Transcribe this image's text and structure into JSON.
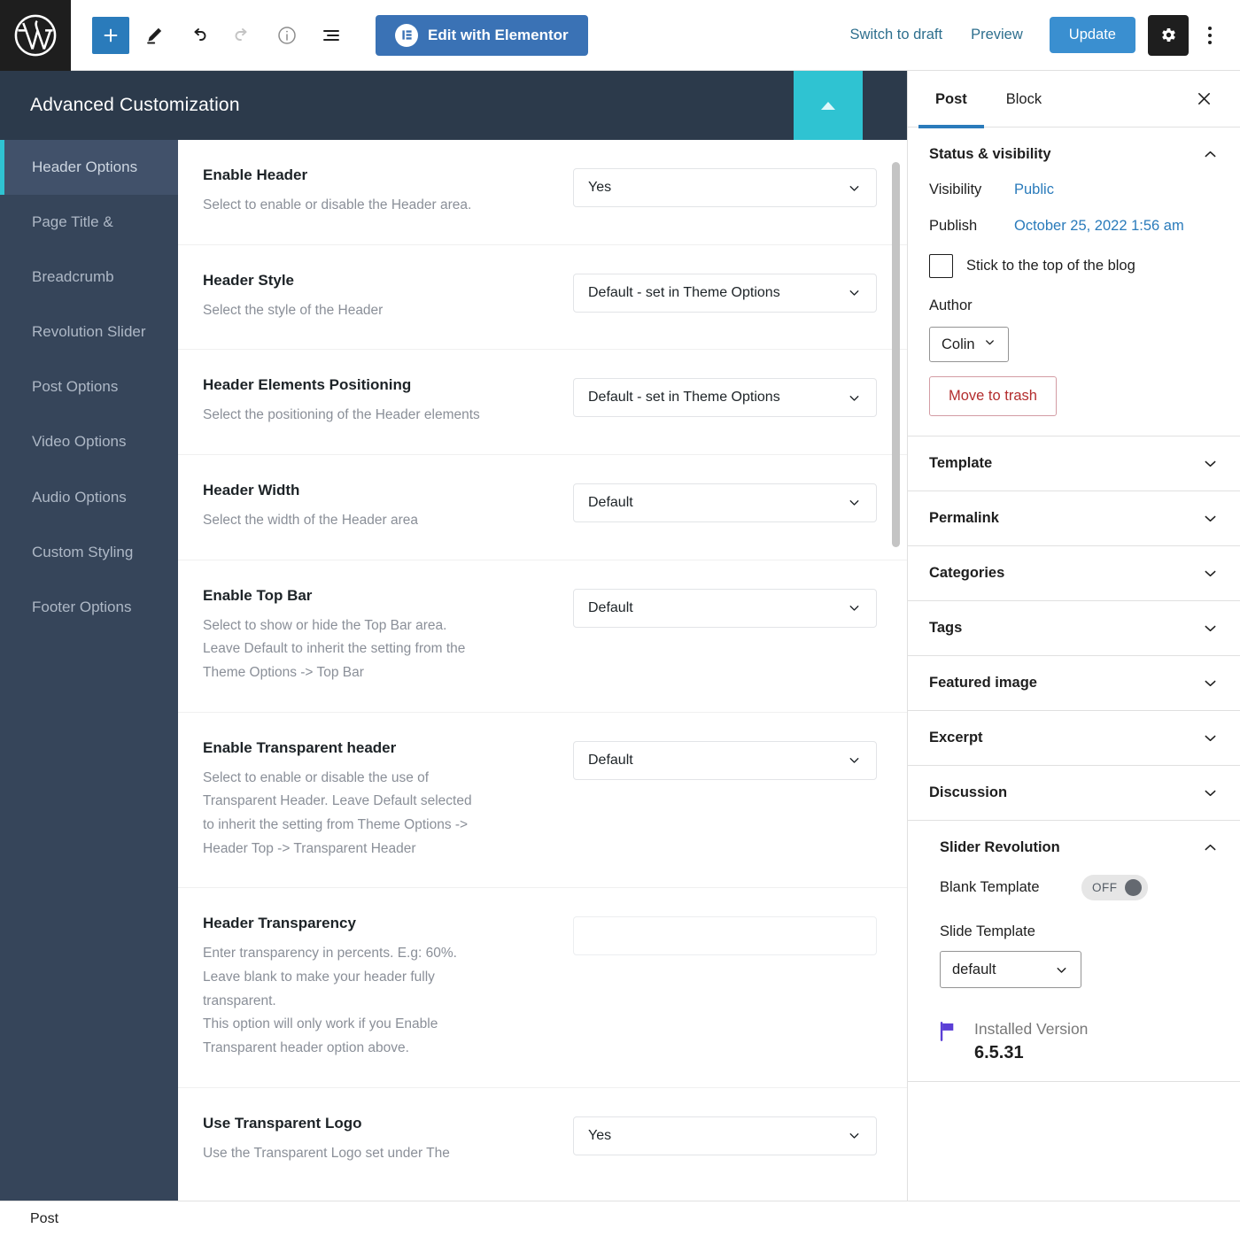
{
  "toolbar": {
    "logo_icon": "wordpress-logo-icon",
    "add_block_label": "+",
    "icons": [
      "add-block-icon",
      "edit-tools-icon",
      "undo-icon",
      "redo-icon",
      "details-info-icon",
      "list-view-icon"
    ],
    "elementor_label": "Edit with Elementor",
    "switch_to_draft_label": "Switch to draft",
    "preview_label": "Preview",
    "update_label": "Update",
    "settings_icon": "gear-icon",
    "options_icon": "kebab-menu-icon",
    "accent_blue": "#3a8fd0",
    "elementor_blue": "#3a72b5"
  },
  "metabox": {
    "title": "Advanced Customization",
    "collapse_icon": "triangle-up-icon",
    "collapse_color": "#2fc3d2",
    "nav": [
      {
        "label": "Header Options",
        "active": true
      },
      {
        "label": "Page Title &",
        "active": false
      },
      {
        "label": "Breadcrumb",
        "active": false
      },
      {
        "label": "Revolution Slider",
        "active": false
      },
      {
        "label": "Post Options",
        "active": false
      },
      {
        "label": "Video Options",
        "active": false
      },
      {
        "label": "Audio Options",
        "active": false
      },
      {
        "label": "Custom Styling",
        "active": false
      },
      {
        "label": "Footer Options",
        "active": false
      }
    ],
    "fields": [
      {
        "label": "Enable Header",
        "desc": "Select to enable or disable the Header area.",
        "control": "select",
        "value": "Yes"
      },
      {
        "label": "Header Style",
        "desc": "Select the style of the Header",
        "control": "select",
        "value": "Default - set in Theme Options"
      },
      {
        "label": "Header Elements Positioning",
        "desc": "Select the positioning of the Header elements",
        "control": "select",
        "value": "Default - set in Theme Options"
      },
      {
        "label": "Header Width",
        "desc": "Select the width of the Header area",
        "control": "select",
        "value": "Default"
      },
      {
        "label": "Enable Top Bar",
        "desc": "Select to show or hide the Top Bar area.\nLeave Default to inherit the setting from the\nTheme Options -> Top Bar",
        "control": "select",
        "value": "Default"
      },
      {
        "label": "Enable Transparent header",
        "desc": "Select to enable or disable the use of\nTransparent Header. Leave Default selected\nto inherit the setting from Theme Options ->\nHeader Top -> Transparent Header",
        "control": "select",
        "value": "Default"
      },
      {
        "label": "Header Transparency",
        "desc": "Enter transparency in percents. E.g: 60%.\nLeave blank to make your header fully\ntransparent.\nThis option will only work if you Enable\nTransparent header option above.",
        "control": "input",
        "value": "",
        "placeholder": ""
      },
      {
        "label": "Use Transparent Logo",
        "desc": "Use the Transparent Logo set under The",
        "control": "select",
        "value": "Yes"
      }
    ]
  },
  "post_panel": {
    "tabs": [
      {
        "label": "Post",
        "active": true
      },
      {
        "label": "Block",
        "active": false
      }
    ],
    "close_icon": "close-icon",
    "status_visibility": {
      "title": "Status & visibility",
      "expanded": true,
      "visibility_label": "Visibility",
      "visibility_value": "Public",
      "publish_label": "Publish",
      "publish_value": "October 25, 2022 1:56 am",
      "sticky_label": "Stick to the top of the blog",
      "sticky_checked": false,
      "author_label": "Author",
      "author_value": "Colin",
      "trash_label": "Move to trash",
      "trash_color": "#b32d2e"
    },
    "sections": [
      {
        "label": "Template",
        "expanded": false
      },
      {
        "label": "Permalink",
        "expanded": false
      },
      {
        "label": "Categories",
        "expanded": false
      },
      {
        "label": "Tags",
        "expanded": false
      },
      {
        "label": "Featured image",
        "expanded": false
      },
      {
        "label": "Excerpt",
        "expanded": false
      },
      {
        "label": "Discussion",
        "expanded": false
      }
    ],
    "slider_revolution": {
      "title": "Slider Revolution",
      "expanded": true,
      "blank_template_label": "Blank Template",
      "blank_template_state": "OFF",
      "slide_template_label": "Slide Template",
      "slide_template_value": "default",
      "installed_version_label": "Installed Version",
      "installed_version_value": "6.5.31",
      "flag_icon": "flag-icon",
      "flag_color": "#5b3fd6"
    }
  },
  "status_bar": {
    "label": "Post"
  }
}
